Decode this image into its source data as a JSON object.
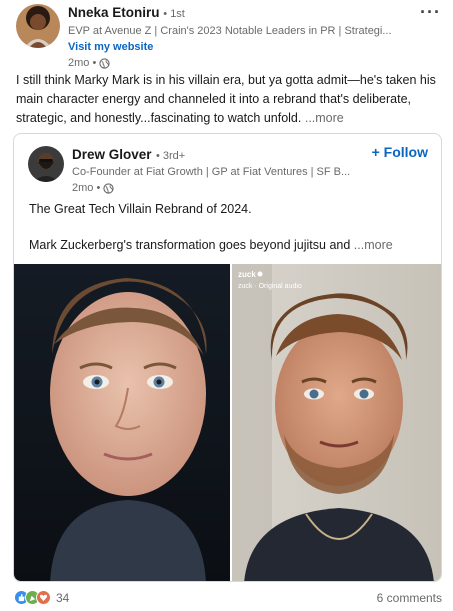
{
  "author": {
    "name": "Nneka Etoniru",
    "degree": "• 1st",
    "headline": "EVP at Avenue Z | Crain's 2023 Notable Leaders in PR | Strategi...",
    "visit_link": "Visit my website",
    "time": "2mo •",
    "avatar_icon": "profile-photo"
  },
  "menu_icon": "more-options-icon",
  "commentary": {
    "text": "I still think Marky Mark is in his villain era, but ya gotta admit—he's taken his main character energy and channeled it into a rebrand that's deliberate, strategic, and honestly...fascinating to watch unfold.",
    "more": "...more"
  },
  "reshared_post": {
    "author": {
      "name": "Drew Glover",
      "degree": "• 3rd+",
      "headline": "Co-Founder at Fiat Growth | GP at Fiat Ventures | SF B...",
      "time": "2mo •"
    },
    "follow_label": "+ Follow",
    "paragraph1": "The Great Tech Villain Rebrand of 2024.",
    "paragraph2": "Mark Zuckerberg's transformation goes beyond jujitsu and",
    "more": "...more",
    "media": {
      "overlay_user": "zuck",
      "overlay_audio": "zuck · Original audio"
    }
  },
  "social": {
    "reaction_count": "34",
    "comments": "6 comments",
    "reaction_colors": [
      "#378fe9",
      "#df704d",
      "#6dae4f"
    ]
  }
}
